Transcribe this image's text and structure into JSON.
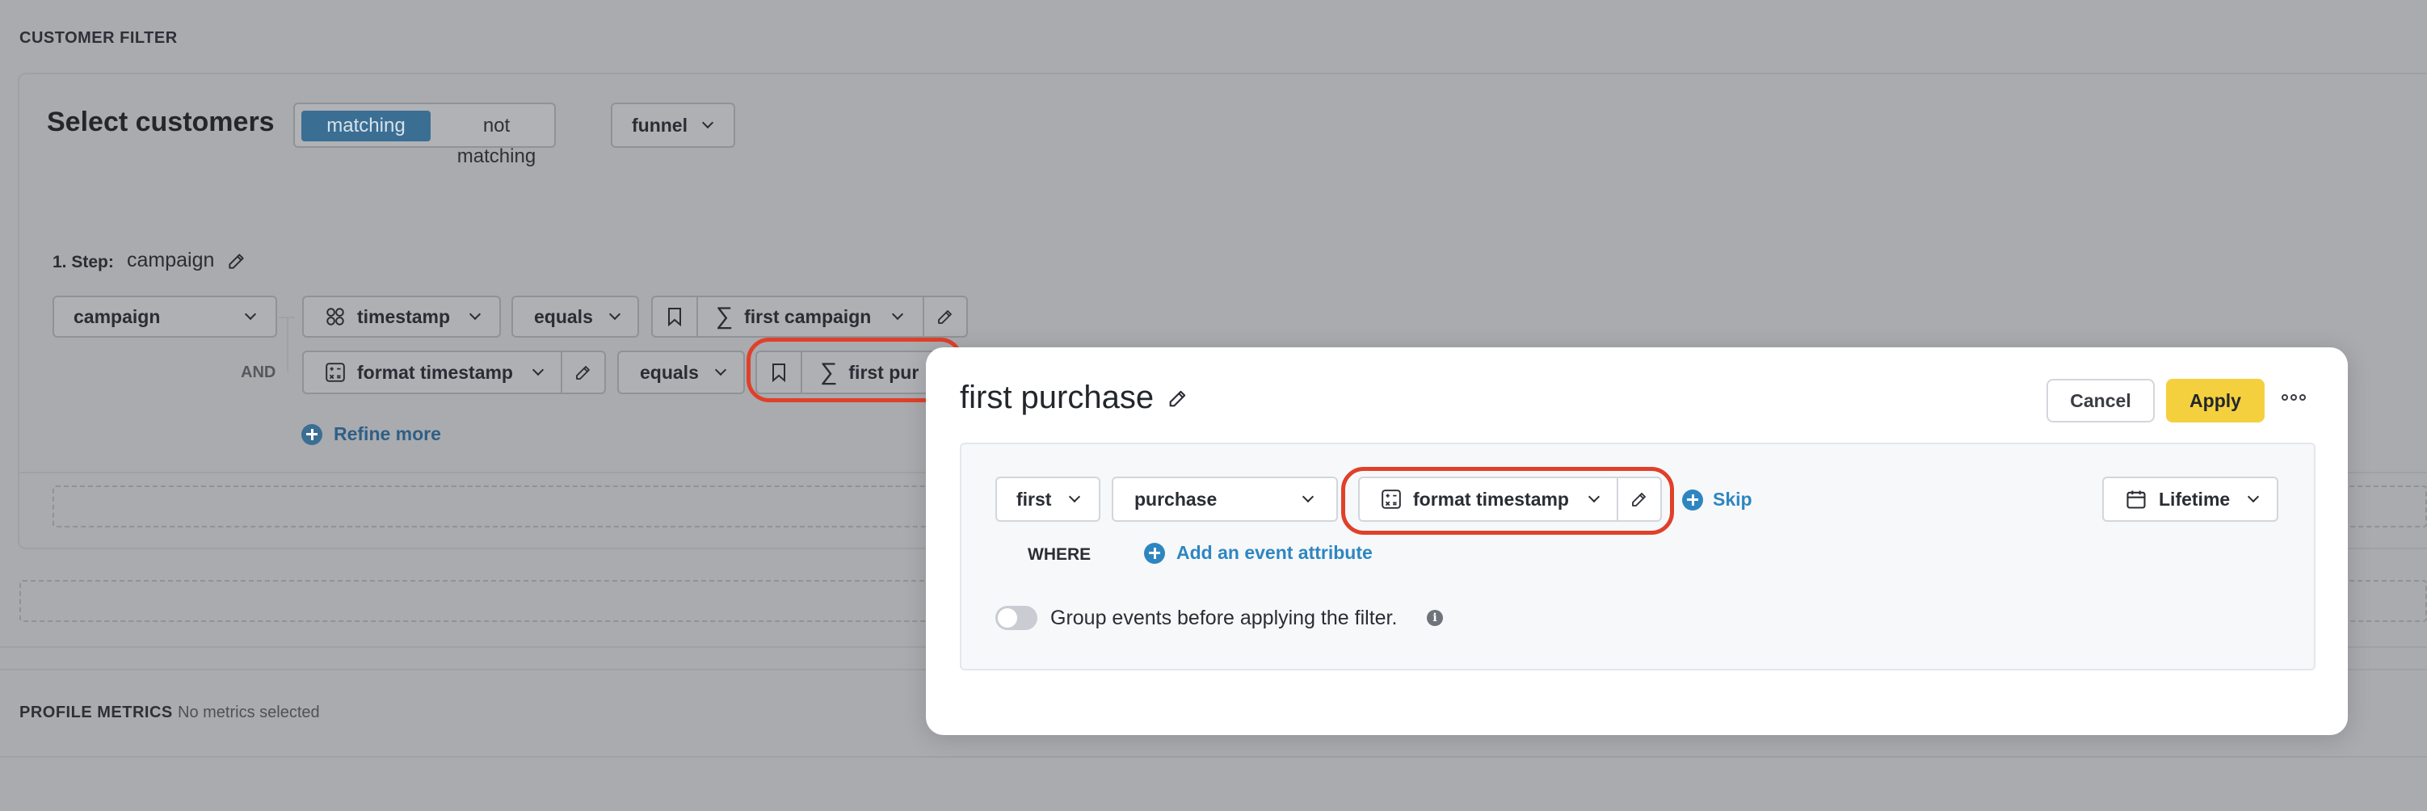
{
  "background": {
    "section_title": "CUSTOMER FILTER",
    "select_title": "Select customers",
    "segment": {
      "active": "matching",
      "inactive": "not matching"
    },
    "mode_dropdown": "funnel",
    "step": {
      "label": "1. Step:",
      "name": "campaign"
    },
    "row1": {
      "event": "campaign",
      "attribute": "timestamp",
      "operator": "equals",
      "value": "first campaign"
    },
    "row2": {
      "connector": "AND",
      "attribute": "format timestamp",
      "operator": "equals",
      "value": "first pur"
    },
    "refine_more": "Refine more",
    "profile_metrics": {
      "title": "PROFILE METRICS",
      "status": "No metrics selected"
    }
  },
  "modal": {
    "title": "first purchase",
    "cancel_label": "Cancel",
    "apply_label": "Apply",
    "occurrence": "first",
    "event": "purchase",
    "attribute": "format timestamp",
    "skip_label": "Skip",
    "time_range": "Lifetime",
    "where_label": "WHERE",
    "add_attribute_label": "Add an event attribute",
    "group_events_label": "Group events before applying the filter.",
    "info_glyph": "i"
  },
  "colors": {
    "accent_blue": "#2e86c1",
    "apply_yellow": "#f4d03f",
    "highlight_red": "#e0402a",
    "dim_background": "#a9abaf"
  }
}
